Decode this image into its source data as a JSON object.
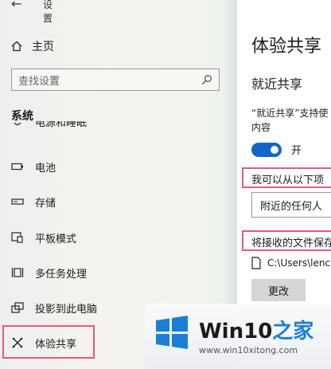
{
  "header": {
    "back_glyph": "←",
    "title": "设置"
  },
  "sidebar": {
    "home_label": "主页",
    "search_placeholder": "查找设置",
    "section_title": "系统",
    "clipped_item": "电源和睡眠",
    "items": [
      {
        "label": "电池",
        "icon": "battery-icon"
      },
      {
        "label": "存储",
        "icon": "storage-icon"
      },
      {
        "label": "平板模式",
        "icon": "tablet-mode-icon"
      },
      {
        "label": "多任务处理",
        "icon": "multitasking-icon"
      },
      {
        "label": "投影到此电脑",
        "icon": "project-icon"
      },
      {
        "label": "体验共享",
        "icon": "shared-experiences-icon",
        "selected": true
      }
    ]
  },
  "content": {
    "title": "体验共享",
    "nearby_heading": "就近共享",
    "nearby_desc_1": "“就近共享”支持使",
    "nearby_desc_2": "内容",
    "toggle_label": "开",
    "receive_from_label": "我可以从以下项",
    "receive_from_value": "附近的任何人",
    "save_to_label": "将接收的文件保存",
    "save_path": "C:\\Users\\lenc",
    "change_button": "更改"
  },
  "watermark": {
    "brand_main": "Win10",
    "brand_accent": "之家",
    "url": "www.win10xitong.com"
  },
  "colors": {
    "accent": "#1366c9",
    "highlight_box": "#e05a8c",
    "logo_blue": "#1a7fd6"
  }
}
